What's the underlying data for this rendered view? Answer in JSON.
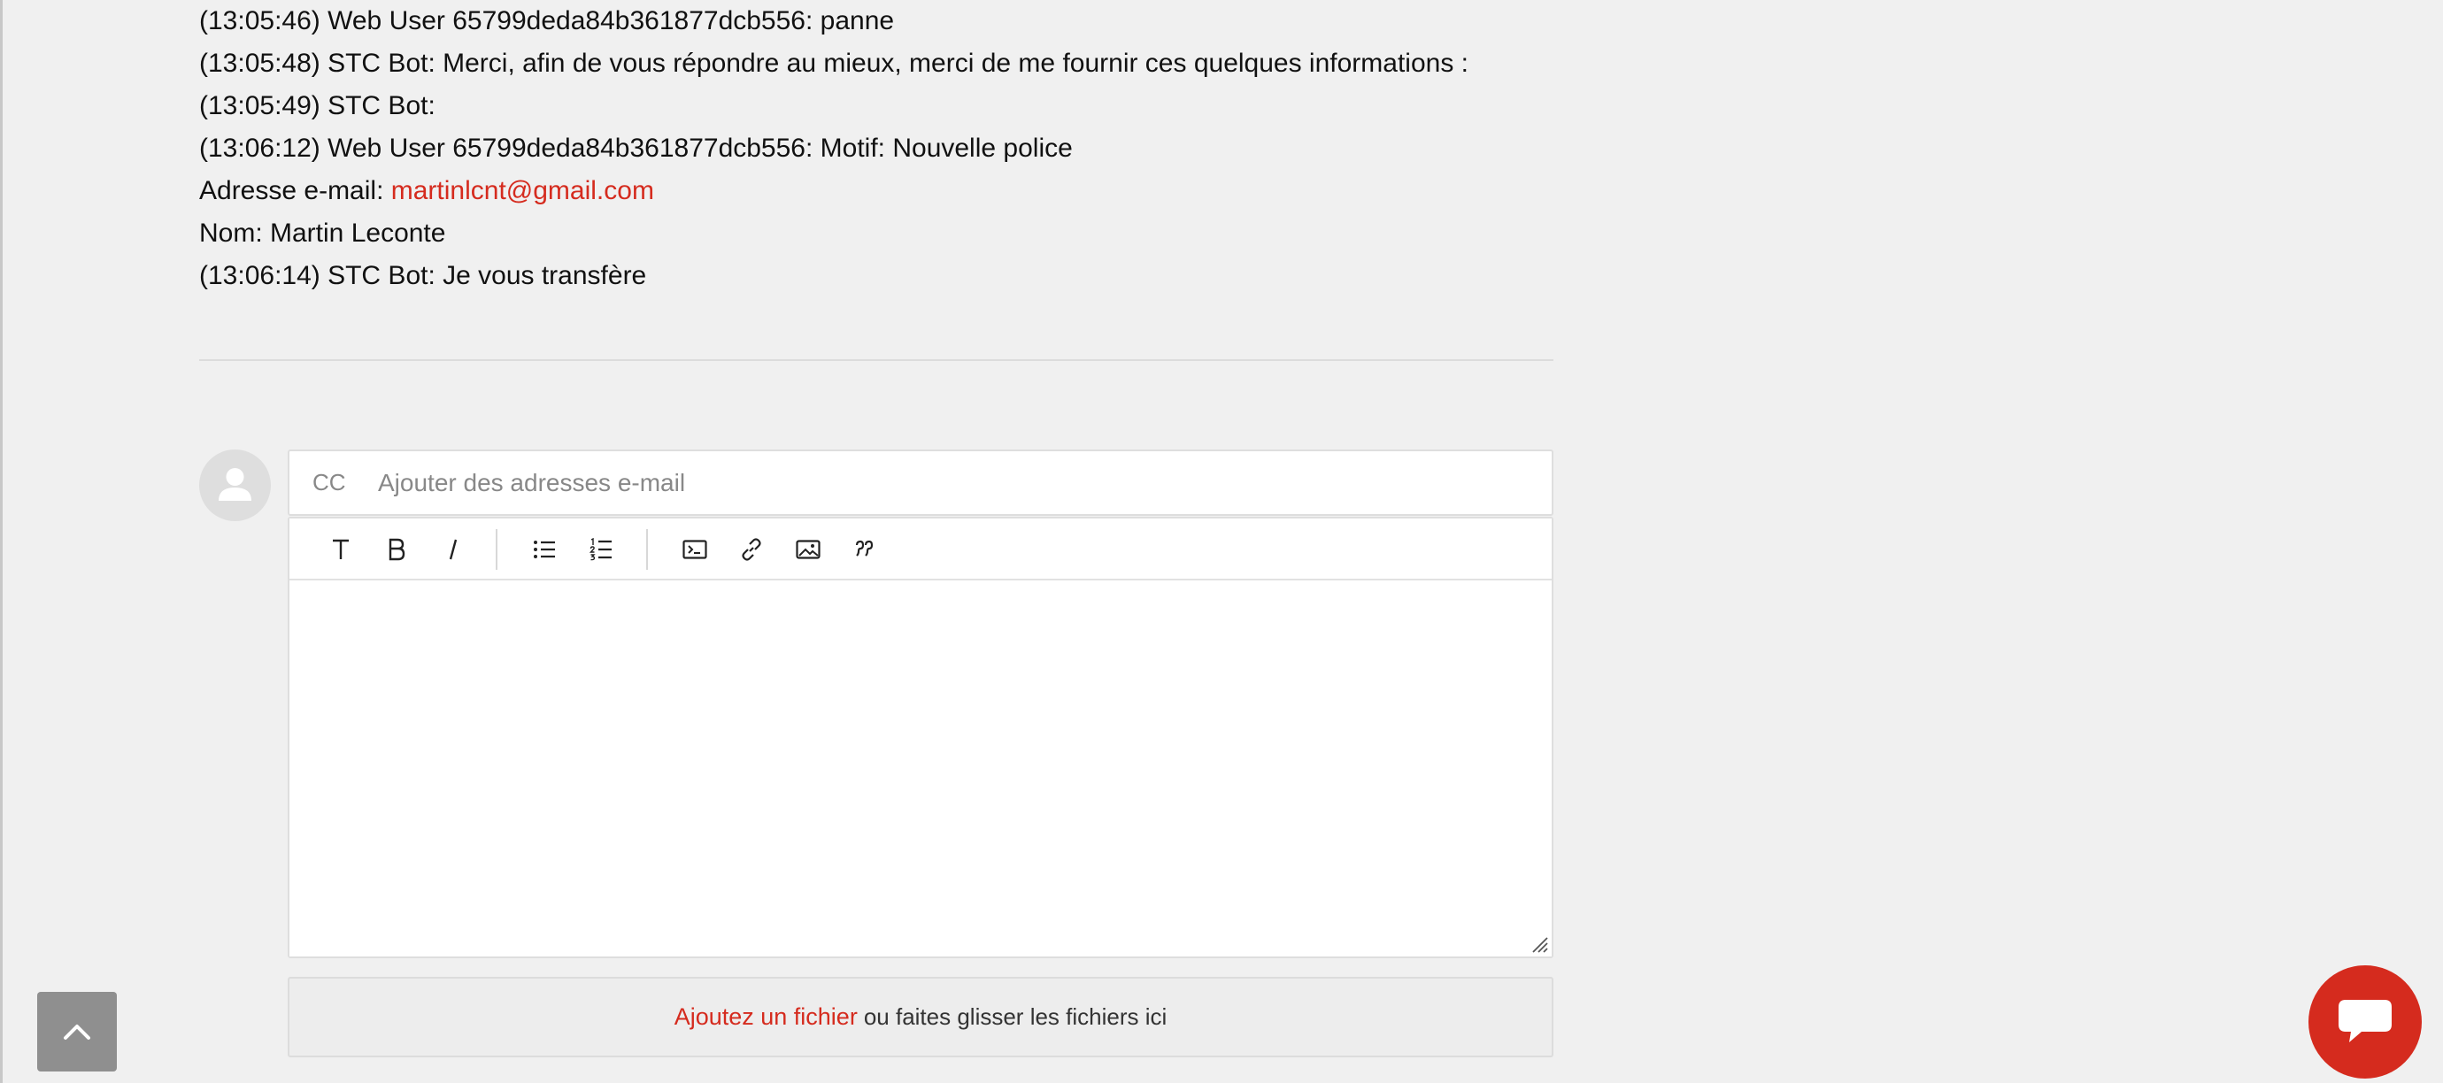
{
  "transcript": {
    "lines": [
      {
        "text": "(13:05:46) Web User 65799deda84b361877dcb556: panne"
      },
      {
        "text": "(13:05:48) STC Bot: Merci, afin de vous répondre au mieux, merci de me fournir ces quelques informations :"
      },
      {
        "text": "(13:05:49) STC Bot:"
      },
      {
        "text": "(13:06:12) Web User 65799deda84b361877dcb556: Motif: Nouvelle police"
      },
      {
        "prefix": "Adresse e-mail: ",
        "link": "martinlcnt@gmail.com"
      },
      {
        "text": "Nom: Martin Leconte"
      },
      {
        "text": "(13:06:14) STC Bot: Je vous transfère"
      }
    ]
  },
  "reply": {
    "cc_label": "CC",
    "cc_placeholder": "Ajouter des adresses e-mail",
    "cc_value": "",
    "toolbar": {
      "groups": [
        [
          "text-format-icon",
          "bold-icon",
          "italic-icon"
        ],
        [
          "bulleted-list-icon",
          "numbered-list-icon"
        ],
        [
          "code-block-icon",
          "link-icon",
          "image-icon",
          "quote-icon"
        ]
      ]
    },
    "editor_value": ""
  },
  "dropzone": {
    "link_label": "Ajoutez un fichier",
    "rest_label": "ou faites glisser les fichiers ici"
  },
  "icons": {
    "avatar": "user-avatar-icon",
    "scroll_top": "chevron-up-icon",
    "chat": "chat-bubble-icon"
  },
  "colors": {
    "accent": "#d52b1e",
    "background": "#f0f0f0",
    "scroll_button": "#8f8f8f"
  }
}
